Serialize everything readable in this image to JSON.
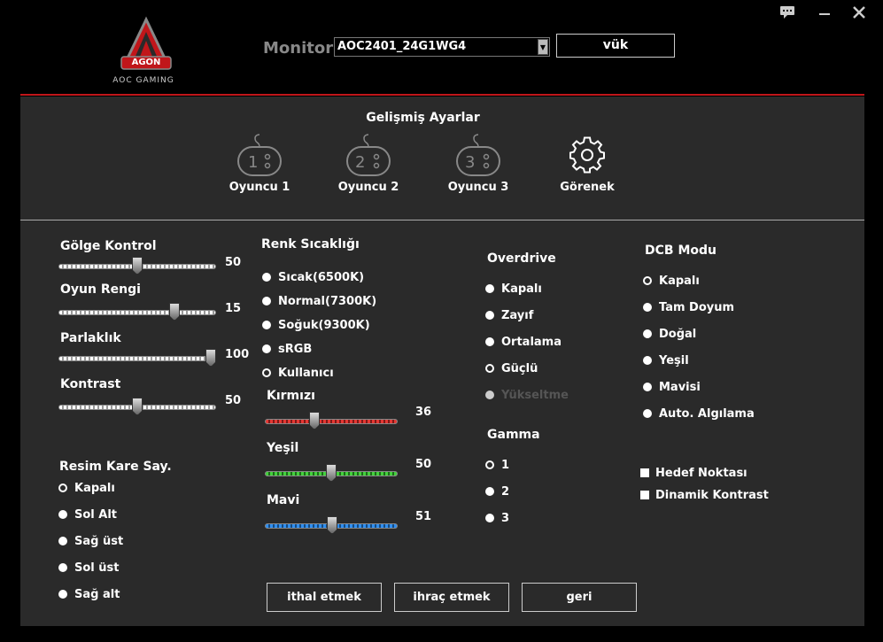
{
  "header": {
    "brand_badge": "AGON",
    "brand_text": "AOC GAMING",
    "monitor_label": "Monitor",
    "monitor_value": "AOC2401_24G1WG4",
    "load_button": "vük",
    "icons": [
      "feedback-icon",
      "minimize-icon",
      "close-icon"
    ]
  },
  "advanced": {
    "title": "Gelişmiş Ayarlar",
    "profiles": [
      {
        "label": "Oyuncu 1",
        "icon": "gamepad-1-icon"
      },
      {
        "label": "Oyuncu 2",
        "icon": "gamepad-2-icon"
      },
      {
        "label": "Oyuncu 3",
        "icon": "gamepad-3-icon"
      },
      {
        "label": "Görenek",
        "icon": "gear-icon"
      }
    ]
  },
  "sliders": {
    "shadow": {
      "label": "Gölge Kontrol",
      "value": "50",
      "level": 50
    },
    "game_color": {
      "label": "Oyun Rengi",
      "value": "15",
      "level": 15,
      "max": 20
    },
    "brightness": {
      "label": "Parlaklık",
      "value": "100",
      "level": 100
    },
    "contrast": {
      "label": "Kontrast",
      "value": "50",
      "level": 50
    }
  },
  "frame_counter": {
    "title": "Resim Kare Say.",
    "options": [
      "Kapalı",
      "Sol Alt",
      "Sağ üst",
      "Sol üst",
      "Sağ alt"
    ],
    "selected": 0
  },
  "color_temp": {
    "title": "Renk Sıcaklığı",
    "options": [
      "Sıcak(6500K)",
      "Normal(7300K)",
      "Soğuk(9300K)",
      "sRGB",
      "Kullanıcı"
    ],
    "selected": 4,
    "red": {
      "label": "Kırmızı",
      "value": "36",
      "level": 36,
      "color": "#e53935"
    },
    "green": {
      "label": "Yeşil",
      "value": "50",
      "level": 50,
      "color": "#43d13c"
    },
    "blue": {
      "label": "Mavi",
      "value": "51",
      "level": 51,
      "color": "#2f8ef0"
    }
  },
  "overdrive": {
    "title": "Overdrive",
    "options": [
      "Kapalı",
      "Zayıf",
      "Ortalama",
      "Güçlü",
      "Yükseltme"
    ],
    "selected": 3,
    "disabled": [
      4
    ]
  },
  "gamma": {
    "title": "Gamma",
    "options": [
      "1",
      "2",
      "3"
    ],
    "selected": 0
  },
  "dcb": {
    "title": "DCB Modu",
    "options": [
      "Kapalı",
      "Tam Doyum",
      "Doğal",
      "Yeşil",
      "Mavisi",
      "Auto. Algılama"
    ],
    "selected": 0
  },
  "checkboxes": [
    "Hedef Noktası",
    "Dinamik Kontrast"
  ],
  "buttons": {
    "import": "ithal etmek",
    "export": "ihraç etmek",
    "back": "geri"
  },
  "colors": {
    "accent": "#c0161a",
    "panel": "#2a2a2a"
  }
}
